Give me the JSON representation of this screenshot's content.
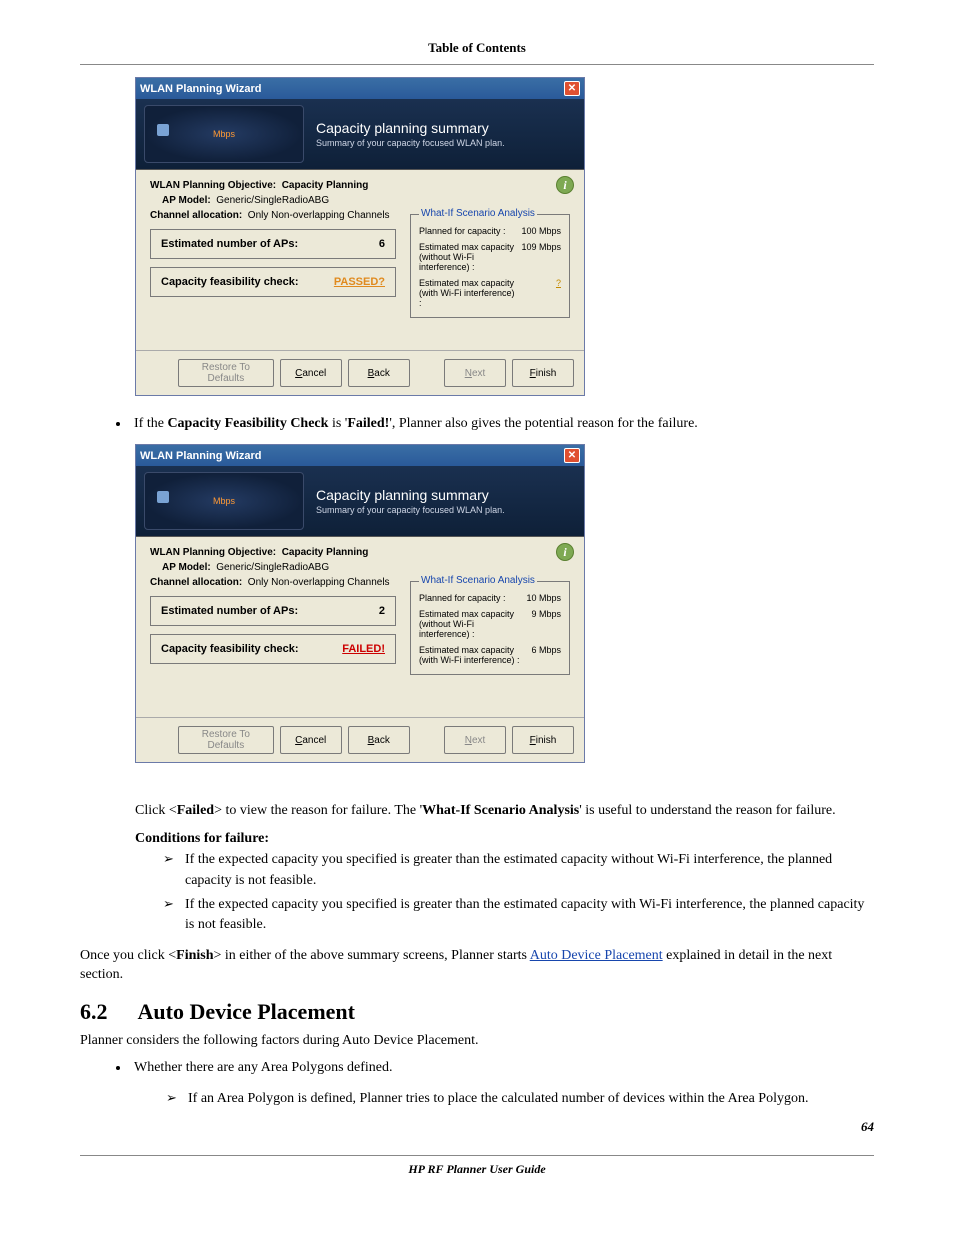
{
  "header": {
    "toc": "Table of Contents"
  },
  "wiz1": {
    "title": "WLAN Planning Wizard",
    "gauge_label": "Mbps",
    "banner_big": "Capacity planning summary",
    "banner_small": "Summary of your capacity focused WLAN plan.",
    "objective_k": "WLAN Planning Objective:",
    "objective_v": "Capacity Planning",
    "apmodel_k": "AP Model:",
    "apmodel_v": "Generic/SingleRadioABG",
    "chan_k": "Channel allocation:",
    "chan_v": "Only Non-overlapping Channels",
    "est_k": "Estimated number of APs:",
    "est_v": "6",
    "feas_k": "Capacity feasibility check:",
    "feas_v": "PASSED?",
    "whatif_title": "What-If Scenario Analysis",
    "w1_k": "Planned for capacity :",
    "w1_v": "100 Mbps",
    "w2_k": "Estimated max capacity (without Wi-Fi interference) :",
    "w2_v": "109 Mbps",
    "w3_k": "Estimated max capacity (with Wi-Fi interference) :",
    "w3_v": "?",
    "btn_restore": "Restore To Defaults",
    "btn_cancel": "Cancel",
    "btn_back": "Back",
    "btn_next": "Next",
    "btn_finish": "Finish"
  },
  "para1": {
    "pre": "If the ",
    "b1": "Capacity Feasibility Check",
    "mid": " is '",
    "b2": "Failed!",
    "post": "', Planner also gives the potential reason for the failure."
  },
  "wiz2": {
    "title": "WLAN Planning Wizard",
    "gauge_label": "Mbps",
    "banner_big": "Capacity planning summary",
    "banner_small": "Summary of your capacity focused WLAN plan.",
    "objective_k": "WLAN Planning Objective:",
    "objective_v": "Capacity Planning",
    "apmodel_k": "AP Model:",
    "apmodel_v": "Generic/SingleRadioABG",
    "chan_k": "Channel allocation:",
    "chan_v": "Only Non-overlapping Channels",
    "est_k": "Estimated number of APs:",
    "est_v": "2",
    "feas_k": "Capacity feasibility check:",
    "feas_v": "FAILED!",
    "whatif_title": "What-If Scenario Analysis",
    "w1_k": "Planned for capacity :",
    "w1_v": "10 Mbps",
    "w2_k": "Estimated max capacity (without Wi-Fi interference) :",
    "w2_v": "9 Mbps",
    "w3_k": "Estimated max capacity (with Wi-Fi interference) :",
    "w3_v": "6 Mbps",
    "btn_restore": "Restore To Defaults",
    "btn_cancel": "Cancel",
    "btn_back": "Back",
    "btn_next": "Next",
    "btn_finish": "Finish"
  },
  "para2": {
    "t1": "Click <",
    "b1": "Failed",
    "t2": "> to view the reason for failure. The '",
    "b2": "What-If Scenario Analysis",
    "t3": "' is useful to understand the reason for failure."
  },
  "cond_heading": "Conditions for failure:",
  "cond1": "If the expected capacity you specified is greater than the estimated capacity without Wi-Fi interference, the planned capacity is not feasible.",
  "cond2": "If the expected capacity you specified is greater than the estimated capacity with Wi-Fi interference, the planned capacity is not feasible.",
  "para3": {
    "t1": "Once you click <",
    "b1": "Finish",
    "t2": "> in either of the above summary screens, Planner starts ",
    "link": "Auto Device Placement",
    "t3": " explained in detail in the next section."
  },
  "section": {
    "num": "6.2",
    "title": "Auto Device Placement"
  },
  "para4": "Planner considers the following factors during Auto Device Placement.",
  "bul1": "Whether there are any Area Polygons defined.",
  "subarrow1": "If an Area Polygon is defined, Planner tries to place the calculated number of devices within the Area Polygon.",
  "footer": {
    "title": "HP RF Planner User Guide",
    "page": "64"
  }
}
